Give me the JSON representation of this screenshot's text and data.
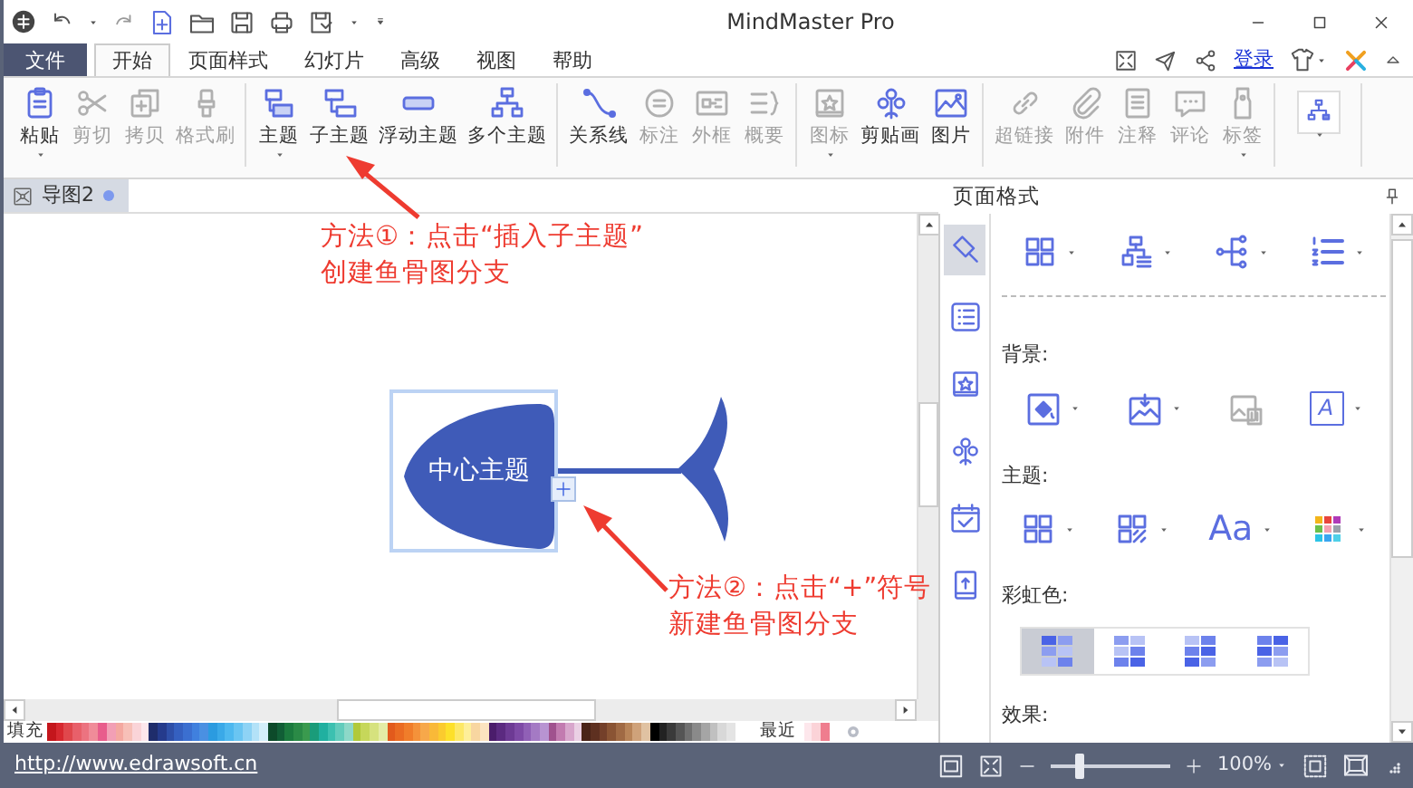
{
  "window": {
    "title": "MindMaster Pro"
  },
  "menu_tabs": [
    {
      "label": "文件",
      "kind": "file",
      "selected": false
    },
    {
      "label": "开始",
      "kind": "tab",
      "selected": true
    },
    {
      "label": "页面样式",
      "kind": "tab",
      "selected": false
    },
    {
      "label": "幻灯片",
      "kind": "tab",
      "selected": false
    },
    {
      "label": "高级",
      "kind": "tab",
      "selected": false
    },
    {
      "label": "视图",
      "kind": "tab",
      "selected": false
    },
    {
      "label": "帮助",
      "kind": "tab",
      "selected": false
    }
  ],
  "account": {
    "login_link": "登录"
  },
  "ribbon": {
    "groups": [
      {
        "buttons": [
          {
            "label": "粘贴",
            "kind": "clipboard",
            "disabled": false,
            "dropdown": true
          },
          {
            "label": "剪切",
            "kind": "scissors",
            "disabled": true,
            "dropdown": false
          },
          {
            "label": "拷贝",
            "kind": "copy",
            "disabled": true,
            "dropdown": false
          },
          {
            "label": "格式刷",
            "kind": "brush",
            "disabled": true,
            "dropdown": false
          }
        ]
      },
      {
        "buttons": [
          {
            "label": "主题",
            "kind": "topic",
            "disabled": false,
            "dropdown": true
          },
          {
            "label": "子主题",
            "kind": "subtopic",
            "disabled": false,
            "dropdown": false
          },
          {
            "label": "浮动主题",
            "kind": "floating",
            "disabled": false,
            "dropdown": false
          },
          {
            "label": "多个主题",
            "kind": "multi",
            "disabled": false,
            "dropdown": false
          }
        ]
      },
      {
        "buttons": [
          {
            "label": "关系线",
            "kind": "relation",
            "disabled": false,
            "dropdown": false
          },
          {
            "label": "标注",
            "kind": "callout",
            "disabled": true,
            "dropdown": false
          },
          {
            "label": "外框",
            "kind": "boundary",
            "disabled": true,
            "dropdown": false
          },
          {
            "label": "概要",
            "kind": "summary",
            "disabled": true,
            "dropdown": false
          }
        ]
      },
      {
        "buttons": [
          {
            "label": "图标",
            "kind": "iconlib",
            "disabled": true,
            "dropdown": true
          },
          {
            "label": "剪贴画",
            "kind": "clipart",
            "disabled": false,
            "dropdown": false
          },
          {
            "label": "图片",
            "kind": "picture",
            "disabled": false,
            "dropdown": false
          }
        ]
      },
      {
        "buttons": [
          {
            "label": "超链接",
            "kind": "link",
            "disabled": true,
            "dropdown": false
          },
          {
            "label": "附件",
            "kind": "attach",
            "disabled": true,
            "dropdown": false
          },
          {
            "label": "注释",
            "kind": "note",
            "disabled": true,
            "dropdown": false
          },
          {
            "label": "评论",
            "kind": "comment",
            "disabled": true,
            "dropdown": false
          },
          {
            "label": "标签",
            "kind": "tag",
            "disabled": true,
            "dropdown": true
          }
        ]
      },
      {
        "buttons": [
          {
            "kind": "layout",
            "disabled": false,
            "dropdown": true
          }
        ]
      }
    ]
  },
  "doc_tabs": [
    {
      "label": "导图2",
      "selected": true,
      "modified": true
    }
  ],
  "canvas": {
    "central_topic": "中心主题",
    "annotations": [
      {
        "lines": [
          "方法①：点击“插入子主题”",
          "创建鱼骨图分支"
        ]
      },
      {
        "lines": [
          "方法②：点击“+”符号",
          "新建鱼骨图分支"
        ]
      }
    ]
  },
  "color_bar": {
    "label": "填充",
    "swatches": [
      {
        "color": "#c4161c"
      },
      {
        "color": "#d7282f"
      },
      {
        "color": "#e0474c"
      },
      {
        "color": "#e8606a"
      },
      {
        "color": "#ec7380"
      },
      {
        "color": "#f08c99"
      },
      {
        "color": "#e85d8c"
      },
      {
        "color": "#f29fb5"
      },
      {
        "color": "#f4a8a0"
      },
      {
        "color": "#f7c0b8"
      },
      {
        "color": "#fad4d8"
      },
      {
        "color": "#fde7ec"
      },
      {
        "color": "#1f2d6b"
      },
      {
        "color": "#253b8c"
      },
      {
        "color": "#2e4fa8"
      },
      {
        "color": "#3560c0"
      },
      {
        "color": "#3b6fd0"
      },
      {
        "color": "#4080de"
      },
      {
        "color": "#4a90e2"
      },
      {
        "color": "#2b9be0"
      },
      {
        "color": "#3aa9e8"
      },
      {
        "color": "#4eb8ef"
      },
      {
        "color": "#6ac5f2"
      },
      {
        "color": "#8ed3f5"
      },
      {
        "color": "#b3e2f8"
      },
      {
        "color": "#d4effa"
      },
      {
        "color": "#0d4a2a"
      },
      {
        "color": "#115e36"
      },
      {
        "color": "#1b7a3e"
      },
      {
        "color": "#2a8a46"
      },
      {
        "color": "#3a9a4e"
      },
      {
        "color": "#1a9c7a"
      },
      {
        "color": "#20b0a0"
      },
      {
        "color": "#3cc0b0"
      },
      {
        "color": "#62ccbc"
      },
      {
        "color": "#8dd8c8"
      },
      {
        "color": "#b1c93a"
      },
      {
        "color": "#c6d75a"
      },
      {
        "color": "#d6e27e"
      },
      {
        "color": "#e4eca6"
      },
      {
        "color": "#e25a1c"
      },
      {
        "color": "#ea6b22"
      },
      {
        "color": "#f07d2a"
      },
      {
        "color": "#f4923a"
      },
      {
        "color": "#f7a84a"
      },
      {
        "color": "#f9b938"
      },
      {
        "color": "#fbcb2e"
      },
      {
        "color": "#fde02a"
      },
      {
        "color": "#fde866"
      },
      {
        "color": "#feef99"
      },
      {
        "color": "#f8d6a0"
      },
      {
        "color": "#fbe3c0"
      },
      {
        "color": "#4b1d6b"
      },
      {
        "color": "#5b2a80"
      },
      {
        "color": "#6d3a94"
      },
      {
        "color": "#7e4aa6"
      },
      {
        "color": "#9060b6"
      },
      {
        "color": "#a47ac4"
      },
      {
        "color": "#b894d2"
      },
      {
        "color": "#a0528e"
      },
      {
        "color": "#c27bb0"
      },
      {
        "color": "#d8a6cc"
      },
      {
        "color": "#ead0e4"
      },
      {
        "color": "#4a2418"
      },
      {
        "color": "#5e3020"
      },
      {
        "color": "#74402a"
      },
      {
        "color": "#8a5434"
      },
      {
        "color": "#a06a44"
      },
      {
        "color": "#b88458"
      },
      {
        "color": "#cfa27a"
      },
      {
        "color": "#e0c2a2"
      },
      {
        "color": "#000000"
      },
      {
        "color": "#222222"
      },
      {
        "color": "#3a3a3a"
      },
      {
        "color": "#555555"
      },
      {
        "color": "#707070"
      },
      {
        "color": "#8a8a8a"
      },
      {
        "color": "#a5a5a5"
      },
      {
        "color": "#c0c0c0"
      },
      {
        "color": "#d8d8d8"
      },
      {
        "color": "#e4e4e4"
      }
    ],
    "recent_label": "最近",
    "recent": [
      {
        "color": "#fde7ec"
      },
      {
        "color": "#fbd3d8"
      },
      {
        "color": "#ef7d8e"
      }
    ]
  },
  "side_panel": {
    "title": "页面格式",
    "tabs": [
      {
        "kind": "style",
        "selected": true
      },
      {
        "kind": "list",
        "selected": false
      },
      {
        "kind": "iconlib",
        "selected": false
      },
      {
        "kind": "clipart",
        "selected": false
      },
      {
        "kind": "task",
        "selected": false
      },
      {
        "kind": "slide",
        "selected": false
      }
    ],
    "sections": [
      {
        "tools": [
          {
            "kind": "grid4",
            "dropdown": true,
            "disabled": false
          },
          {
            "kind": "tree",
            "dropdown": true,
            "disabled": false
          },
          {
            "kind": "mindmap",
            "dropdown": true,
            "disabled": false
          },
          {
            "kind": "numlist",
            "dropdown": true,
            "disabled": false
          }
        ]
      },
      {
        "label": "背景:",
        "tools": [
          {
            "kind": "fill",
            "dropdown": true,
            "disabled": false
          },
          {
            "kind": "bgimage",
            "dropdown": true,
            "disabled": false
          },
          {
            "kind": "bgremove",
            "dropdown": false,
            "disabled": true
          },
          {
            "kind": "text",
            "text": "A",
            "dropdown": true,
            "disabled": false
          }
        ]
      },
      {
        "label": "主题:",
        "tools": [
          {
            "kind": "grid4",
            "dropdown": true,
            "disabled": false
          },
          {
            "kind": "grid4b",
            "dropdown": true,
            "disabled": false
          },
          {
            "kind": "font",
            "text": "Aa",
            "dropdown": true,
            "disabled": false
          },
          {
            "kind": "palette",
            "dropdown": true,
            "disabled": false
          }
        ]
      },
      {
        "label": "彩虹色:",
        "options": [
          {
            "selected": true
          },
          {
            "selected": false
          },
          {
            "selected": false
          },
          {
            "selected": false
          }
        ]
      },
      {
        "label": "效果:"
      }
    ]
  },
  "status_bar": {
    "link": "http://www.edrawsoft.cn",
    "zoom_slider": {
      "level": 0.24
    },
    "zoom": "100%"
  }
}
